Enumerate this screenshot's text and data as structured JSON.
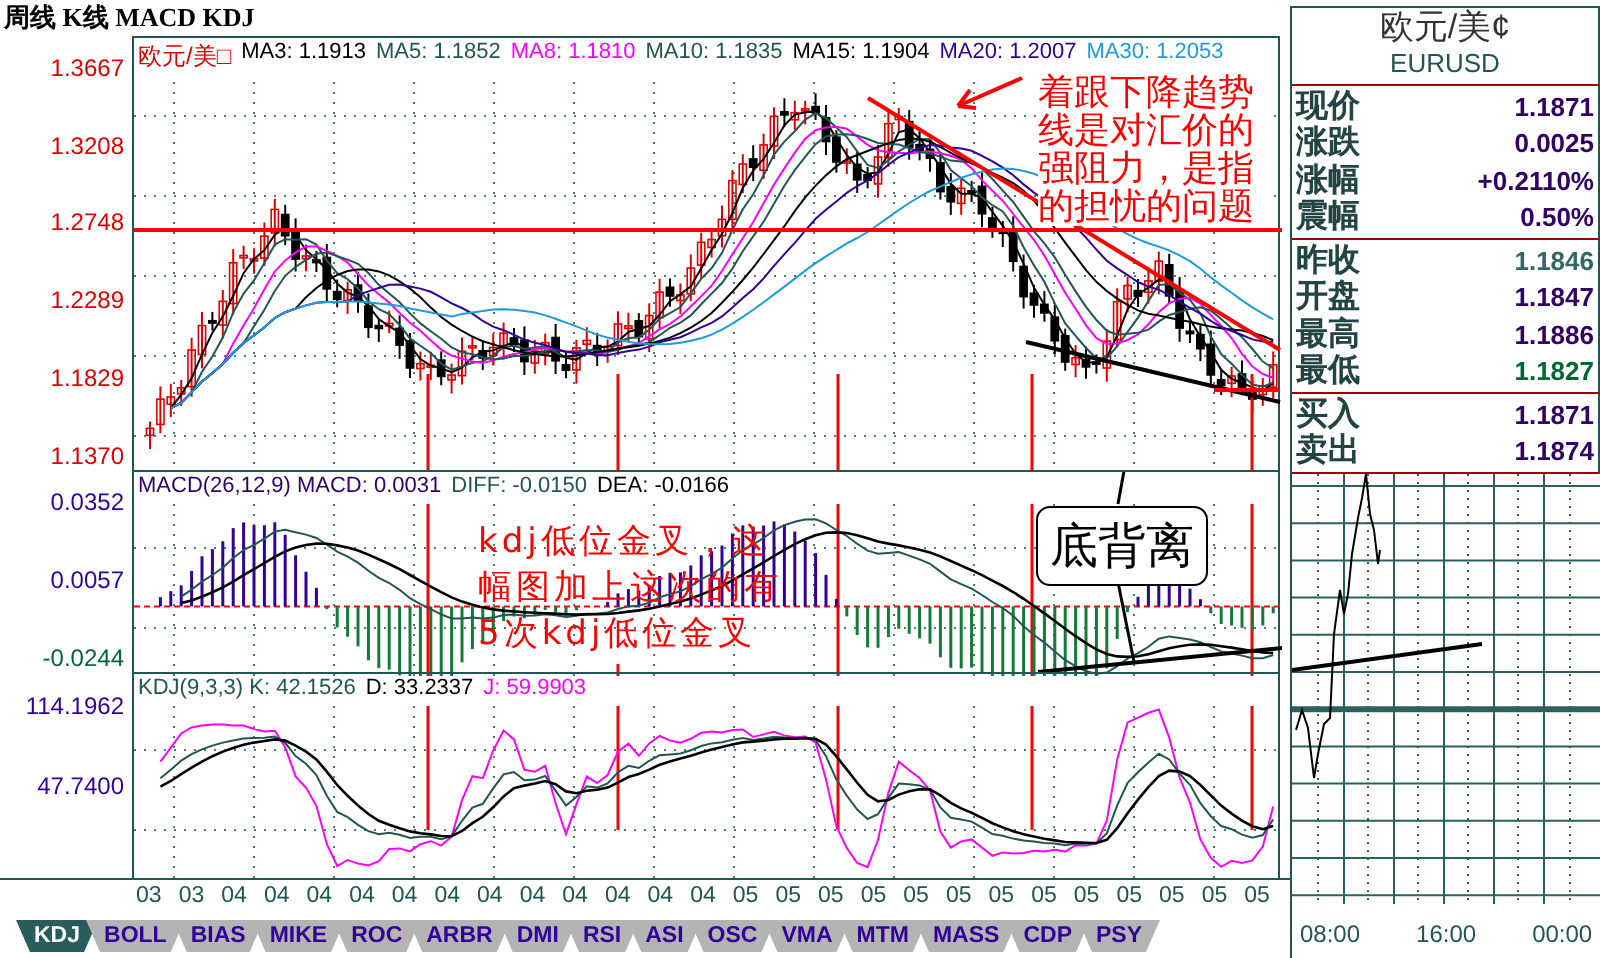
{
  "title": "周线 K线 MACD KDJ",
  "price_panel": {
    "symbol": "欧元/美□",
    "legend": [
      {
        "label": "MA3: 1.1913",
        "color": "#000000"
      },
      {
        "label": "MA5: 1.1852",
        "color": "#225555"
      },
      {
        "label": "MA8: 1.1810",
        "color": "#ff00ff"
      },
      {
        "label": "MA10: 1.1835",
        "color": "#225555"
      },
      {
        "label": "MA15: 1.1904",
        "color": "#000000"
      },
      {
        "label": "MA20: 1.2007",
        "color": "#330099"
      },
      {
        "label": "MA30: 1.2053",
        "color": "#1e9bdc"
      }
    ],
    "y_labels": [
      "1.3667",
      "1.3208",
      "1.2748",
      "1.2289",
      "1.1829",
      "1.1370"
    ],
    "annotation": "着跟下降趋势线是对汇价的强阻力，是指的担忧的问题"
  },
  "macd_panel": {
    "legend": [
      {
        "label": "MACD(26,12,9) MACD: 0.0031",
        "color": "#330066"
      },
      {
        "label": "DIFF: -0.0150",
        "color": "#225555"
      },
      {
        "label": "DEA: -0.0166",
        "color": "#000000"
      }
    ],
    "y_labels": [
      "0.0352",
      "0.0057",
      "-0.0244"
    ],
    "annotation": "kdj低位金叉，这幅图加上这次的有5次kdj低位金叉",
    "callout": "底背离"
  },
  "kdj_panel": {
    "legend": [
      {
        "label": "KDJ(9,3,3) K: 42.1526",
        "color": "#225555"
      },
      {
        "label": "D: 33.2337",
        "color": "#000000"
      },
      {
        "label": "J: 59.9903",
        "color": "#ff00ff"
      }
    ],
    "y_labels": [
      "114.1962",
      "47.7400"
    ]
  },
  "x_labels": [
    "03",
    "03",
    "04",
    "04",
    "04",
    "04",
    "04",
    "04",
    "04",
    "04",
    "04",
    "04",
    "04",
    "04",
    "05",
    "05",
    "05",
    "05",
    "05",
    "05",
    "05",
    "05",
    "05",
    "05",
    "05",
    "05",
    "05"
  ],
  "tabs": [
    {
      "label": "KDJ",
      "selected": true
    },
    {
      "label": "BOLL",
      "selected": false
    },
    {
      "label": "BIAS",
      "selected": false
    },
    {
      "label": "MIKE",
      "selected": false
    },
    {
      "label": "ROC",
      "selected": false
    },
    {
      "label": "ARBR",
      "selected": false
    },
    {
      "label": "DMI",
      "selected": false
    },
    {
      "label": "RSI",
      "selected": false
    },
    {
      "label": "ASI",
      "selected": false
    },
    {
      "label": "OSC",
      "selected": false
    },
    {
      "label": "VMA",
      "selected": false
    },
    {
      "label": "MTM",
      "selected": false
    },
    {
      "label": "MASS",
      "selected": false
    },
    {
      "label": "CDP",
      "selected": false
    },
    {
      "label": "PSY",
      "selected": false
    }
  ],
  "quote": {
    "name": "欧元/美¢",
    "code": "EURUSD",
    "groups": [
      [
        {
          "label": "现价",
          "value": "1.1871",
          "color": "#330066"
        },
        {
          "label": "涨跌",
          "value": "0.0025",
          "color": "#330066"
        },
        {
          "label": "涨幅",
          "value": "+0.2110%",
          "color": "#330066"
        },
        {
          "label": "震幅",
          "value": "0.50%",
          "color": "#330066"
        }
      ],
      [
        {
          "label": "昨收",
          "value": "1.1846",
          "color": "#336666"
        },
        {
          "label": "开盘",
          "value": "1.1847",
          "color": "#330066"
        },
        {
          "label": "最高",
          "value": "1.1886",
          "color": "#330066"
        },
        {
          "label": "最低",
          "value": "1.1827",
          "color": "#006633"
        }
      ],
      [
        {
          "label": "买入",
          "value": "1.1871",
          "color": "#330066"
        },
        {
          "label": "卖出",
          "value": "1.1874",
          "color": "#330066"
        }
      ]
    ]
  },
  "intraday": {
    "x_labels": [
      "08:00",
      "16:00",
      "00:00"
    ]
  }
}
